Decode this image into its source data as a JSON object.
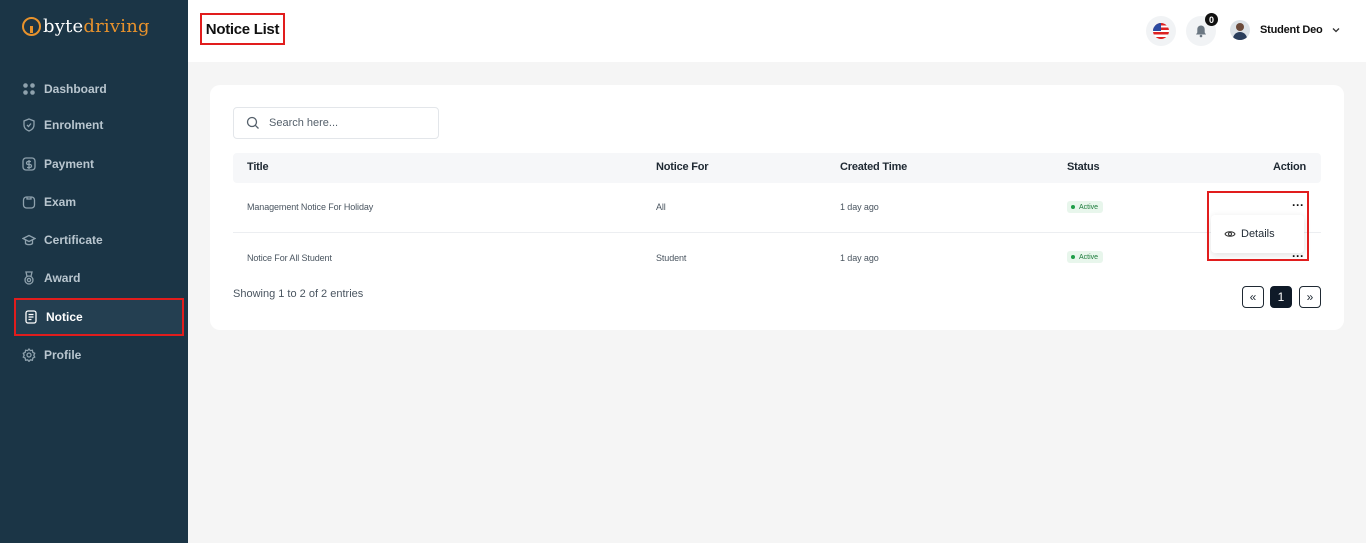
{
  "app": {
    "logo_a": "byte",
    "logo_b": "driving"
  },
  "sidebar": {
    "items": [
      {
        "label": "Dashboard",
        "icon": "grid-icon"
      },
      {
        "label": "Enrolment",
        "icon": "badge-icon"
      },
      {
        "label": "Payment",
        "icon": "dollar-icon"
      },
      {
        "label": "Exam",
        "icon": "clipboard-icon"
      },
      {
        "label": "Certificate",
        "icon": "graduation-cap-icon"
      },
      {
        "label": "Award",
        "icon": "medal-icon"
      },
      {
        "label": "Notice",
        "icon": "document-icon",
        "active": true
      },
      {
        "label": "Profile",
        "icon": "gear-icon"
      }
    ]
  },
  "header": {
    "title": "Notice List",
    "notification_count": "0",
    "user_name": "Student Deo"
  },
  "search": {
    "placeholder": "Search here..."
  },
  "table": {
    "columns": [
      "Title",
      "Notice For",
      "Created Time",
      "Status",
      "Action"
    ],
    "rows": [
      {
        "title": "Management Notice For Holiday",
        "notice_for": "All",
        "created": "1 day ago",
        "status": "Active"
      },
      {
        "title": "Notice For All Student",
        "notice_for": "Student",
        "created": "1 day ago",
        "status": "Active"
      }
    ]
  },
  "action_menu": {
    "details_label": "Details"
  },
  "pagination": {
    "summary": "Showing 1 to 2 of 2 entries",
    "prev": "«",
    "current": "1",
    "next": "»"
  },
  "colors": {
    "sidebar_bg": "#1b3546",
    "brand_orange": "#e8922c",
    "highlight_red": "#e11d1d",
    "active_green": "#1f9d48"
  }
}
